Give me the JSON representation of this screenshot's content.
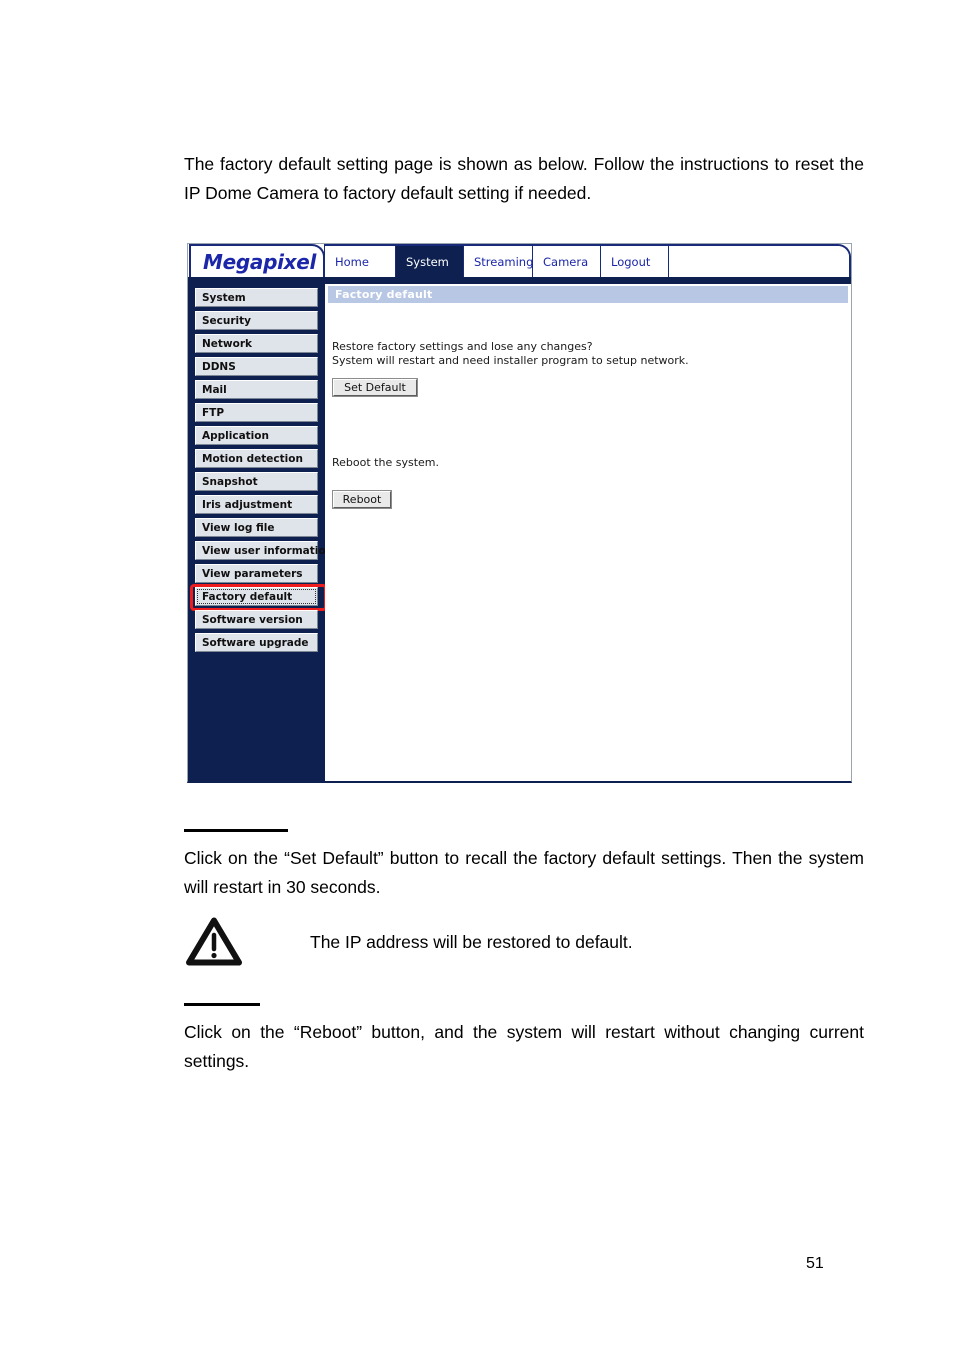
{
  "document": {
    "intro_paragraph": "The factory default setting page is shown as below. Follow the instructions to reset the IP Dome Camera to factory default setting if needed.",
    "set_default_paragraph": "Click on the “Set Default” button to recall the factory default settings. Then the system will restart in 30 seconds.",
    "reboot_paragraph": "Click on the “Reboot” button, and the system will restart without changing current settings.",
    "warning_note": "The IP address will be restored to default.",
    "warning_icon": "warning-triangle-icon",
    "page_number": "51"
  },
  "screenshot": {
    "logo": "Megapixel",
    "tabs": [
      {
        "label": "Home",
        "active": false
      },
      {
        "label": "System",
        "active": true
      },
      {
        "label": "Streaming",
        "active": false
      },
      {
        "label": "Camera",
        "active": false
      },
      {
        "label": "Logout",
        "active": false
      }
    ],
    "sidebar": {
      "items": [
        {
          "label": "System",
          "selected": false
        },
        {
          "label": "Security",
          "selected": false
        },
        {
          "label": "Network",
          "selected": false
        },
        {
          "label": "DDNS",
          "selected": false
        },
        {
          "label": "Mail",
          "selected": false
        },
        {
          "label": "FTP",
          "selected": false
        },
        {
          "label": "Application",
          "selected": false
        },
        {
          "label": "Motion detection",
          "selected": false
        },
        {
          "label": "Snapshot",
          "selected": false
        },
        {
          "label": "Iris adjustment",
          "selected": false
        },
        {
          "label": "View log file",
          "selected": false
        },
        {
          "label": "View user information",
          "selected": false
        },
        {
          "label": "View parameters",
          "selected": false
        },
        {
          "label": "Factory default",
          "selected": true
        },
        {
          "label": "Software version",
          "selected": false
        },
        {
          "label": "Software upgrade",
          "selected": false
        }
      ]
    },
    "panel": {
      "title": "Factory default",
      "restore_line1": "Restore factory settings and lose any changes?",
      "restore_line2": "System will restart and need installer program to setup network.",
      "set_default_button": "Set Default",
      "reboot_message": "Reboot the system.",
      "reboot_button": "Reboot"
    },
    "colors": {
      "navy": "#0d2050",
      "logo_blue": "#1b27a8",
      "title_bar": "#b8c7e4",
      "menu_bg": "#dfe3ea",
      "annotation_red": "#ee1c1c"
    }
  }
}
